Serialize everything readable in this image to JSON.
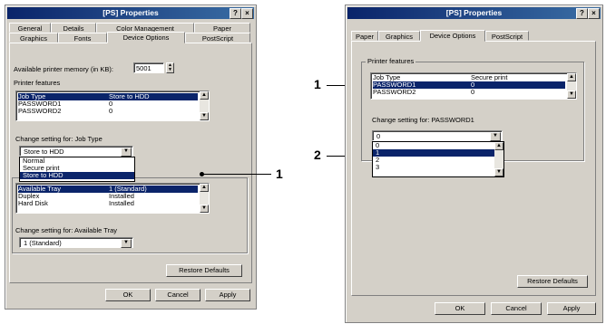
{
  "left": {
    "title": "[PS] Properties",
    "help_btn": "?",
    "close_btn": "×",
    "tabs_top": [
      "General",
      "Details",
      "Color Management",
      "Paper"
    ],
    "tabs_bottom": [
      "Graphics",
      "Fonts",
      "Device Options",
      "PostScript"
    ],
    "memory_label": "Available printer memory (in KB):",
    "memory_value": "5001",
    "features_label": "Printer features",
    "features_rows": [
      {
        "name": "Job Type",
        "value": "Store to HDD"
      },
      {
        "name": "PASSWORD1",
        "value": "0"
      },
      {
        "name": "PASSWORD2",
        "value": "0"
      }
    ],
    "change_label": "Change setting for:  Job Type",
    "combo_value": "Store to HDD",
    "dropdown_items": [
      "Normal",
      "Secure print",
      "Store to HDD"
    ],
    "group2_rows": [
      {
        "name": "Available Tray",
        "value": "1 (Standard)"
      },
      {
        "name": "Duplex",
        "value": "Installed"
      },
      {
        "name": "Hard Disk",
        "value": "Installed"
      }
    ],
    "change2_label": "Change setting for:  Available Tray",
    "combo2_value": "1 (Standard)",
    "restore_btn": "Restore Defaults",
    "ok_btn": "OK",
    "cancel_btn": "Cancel",
    "apply_btn": "Apply"
  },
  "right": {
    "title": "[PS] Properties",
    "help_btn": "?",
    "close_btn": "×",
    "tabs": [
      "Paper",
      "Graphics",
      "Device Options",
      "PostScript"
    ],
    "features_label": "Printer features",
    "features_rows": [
      {
        "name": "Job Type",
        "value": "Secure print"
      },
      {
        "name": "PASSWORD1",
        "value": "0"
      },
      {
        "name": "PASSWORD2",
        "value": "0"
      }
    ],
    "change_label": "Change setting for:  PASSWORD1",
    "combo_value": "0",
    "dropdown_items": [
      "0",
      "1",
      "2",
      "3"
    ],
    "restore_btn": "Restore Defaults",
    "ok_btn": "OK",
    "cancel_btn": "Cancel",
    "apply_btn": "Apply"
  },
  "callouts": {
    "left_1": "1",
    "right_1": "1",
    "right_2": "2"
  }
}
